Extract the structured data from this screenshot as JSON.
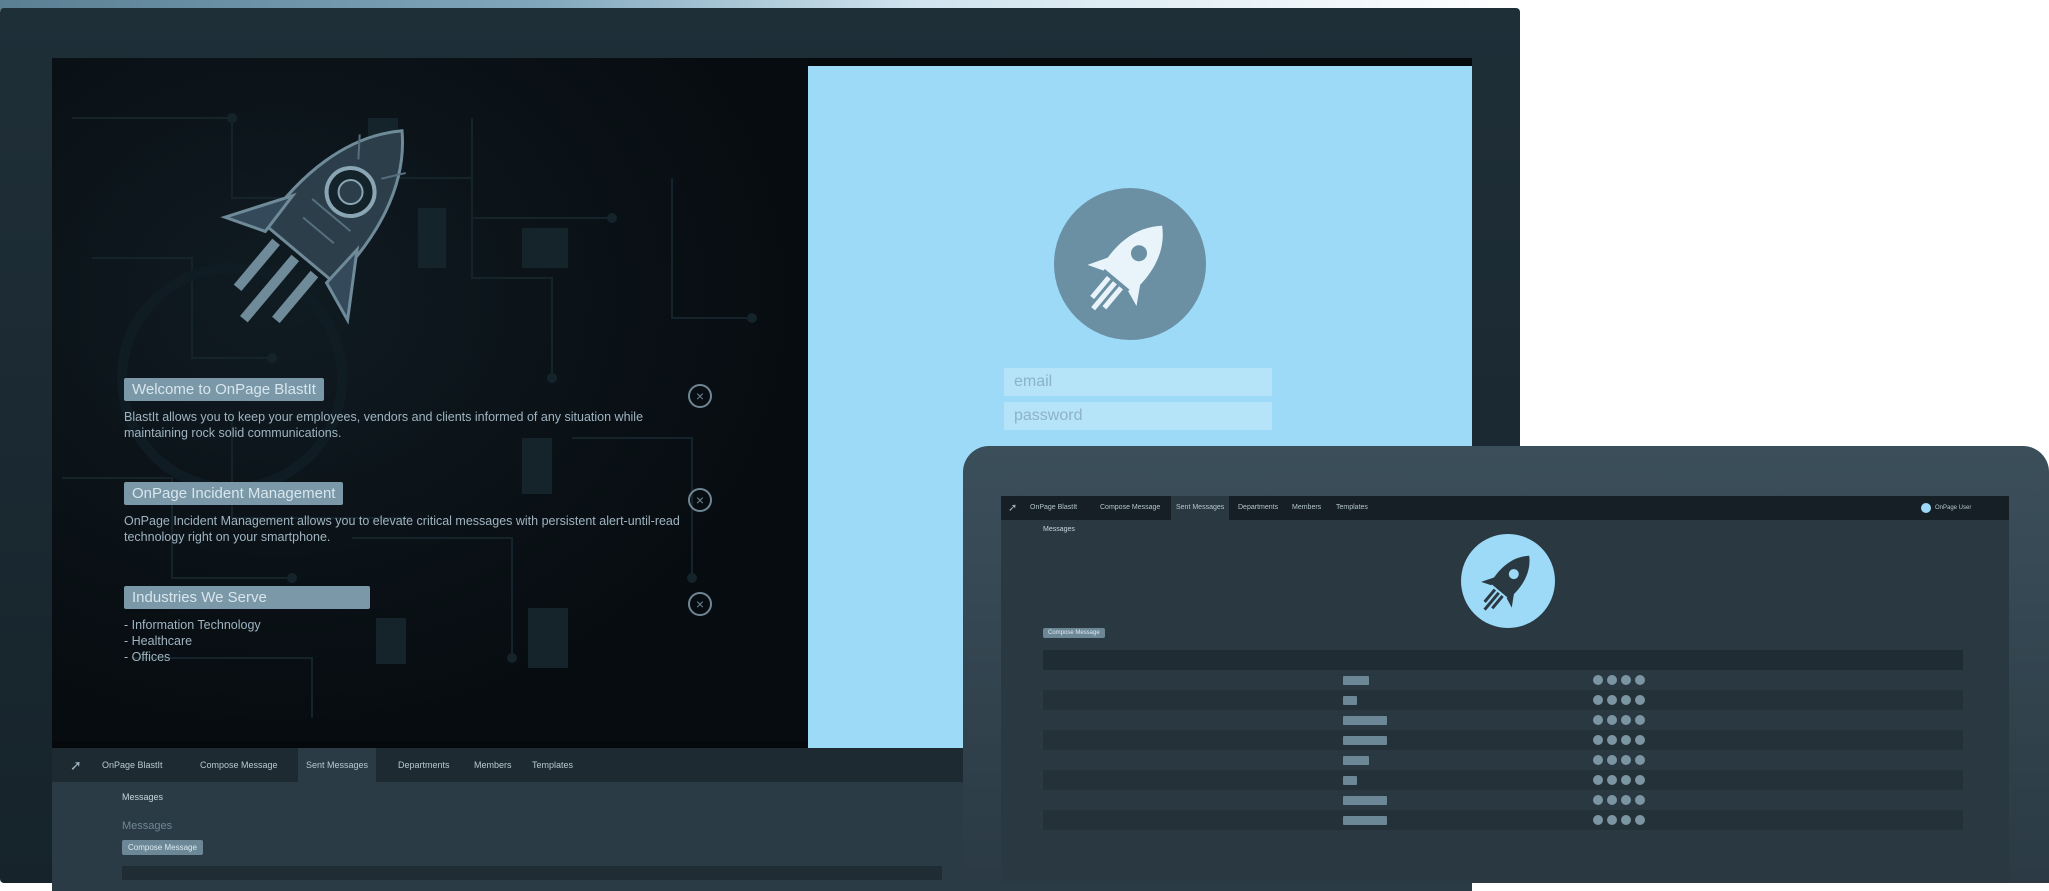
{
  "monitor": {
    "accordion": [
      {
        "title": "Welcome to OnPage BlastIt",
        "body": "BlastIt allows you to keep your employees, vendors and clients informed of any situation while maintaining rock solid communications."
      },
      {
        "title": "OnPage Incident Management",
        "body": "OnPage Incident Management allows you to elevate critical messages with persistent alert-until-read technology right on your smartphone."
      },
      {
        "title": "Industries We Serve",
        "items": [
          "- Information Technology",
          "- Healthcare",
          "- Offices"
        ]
      }
    ],
    "login": {
      "email_placeholder": "email",
      "password_placeholder": "password"
    },
    "dashboard": {
      "tabs": [
        "OnPage BlastIt",
        "Compose Message",
        "Sent Messages",
        "Departments",
        "Members",
        "Templates"
      ],
      "active_tab": 2,
      "page_title": "Messages",
      "section_label": "Messages",
      "compose_button": "Compose Message"
    }
  },
  "laptop": {
    "tabs": [
      "OnPage BlastIt",
      "Compose Message",
      "Sent Messages",
      "Departments",
      "Members",
      "Templates"
    ],
    "active_tab": 2,
    "user_label": "OnPage User",
    "page_title": "Messages",
    "compose_button": "Compose Message"
  },
  "colors": {
    "accent": "#9cdaf7",
    "dark_bg": "#05090c",
    "panel": "#2b3b45"
  }
}
